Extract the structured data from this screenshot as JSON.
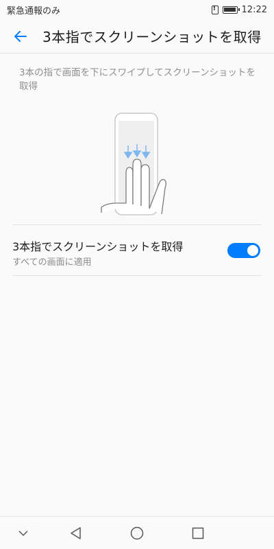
{
  "status_bar": {
    "carrier_text": "緊急通報のみ",
    "time": "12:22"
  },
  "header": {
    "title": "3本指でスクリーンショットを取得",
    "back_icon": "arrow-left-icon"
  },
  "description": "3本の指で画面を下にスワイプしてスクリーンショットを取得",
  "setting": {
    "title": "3本指でスクリーンショットを取得",
    "summary": "すべての画面に適用",
    "enabled": true
  },
  "colors": {
    "accent": "#007dff",
    "arrows": "#7fb6f0"
  },
  "nav_bar": {
    "icons": [
      "chevron-down-icon",
      "back-triangle-icon",
      "home-circle-icon",
      "recents-square-icon"
    ]
  }
}
